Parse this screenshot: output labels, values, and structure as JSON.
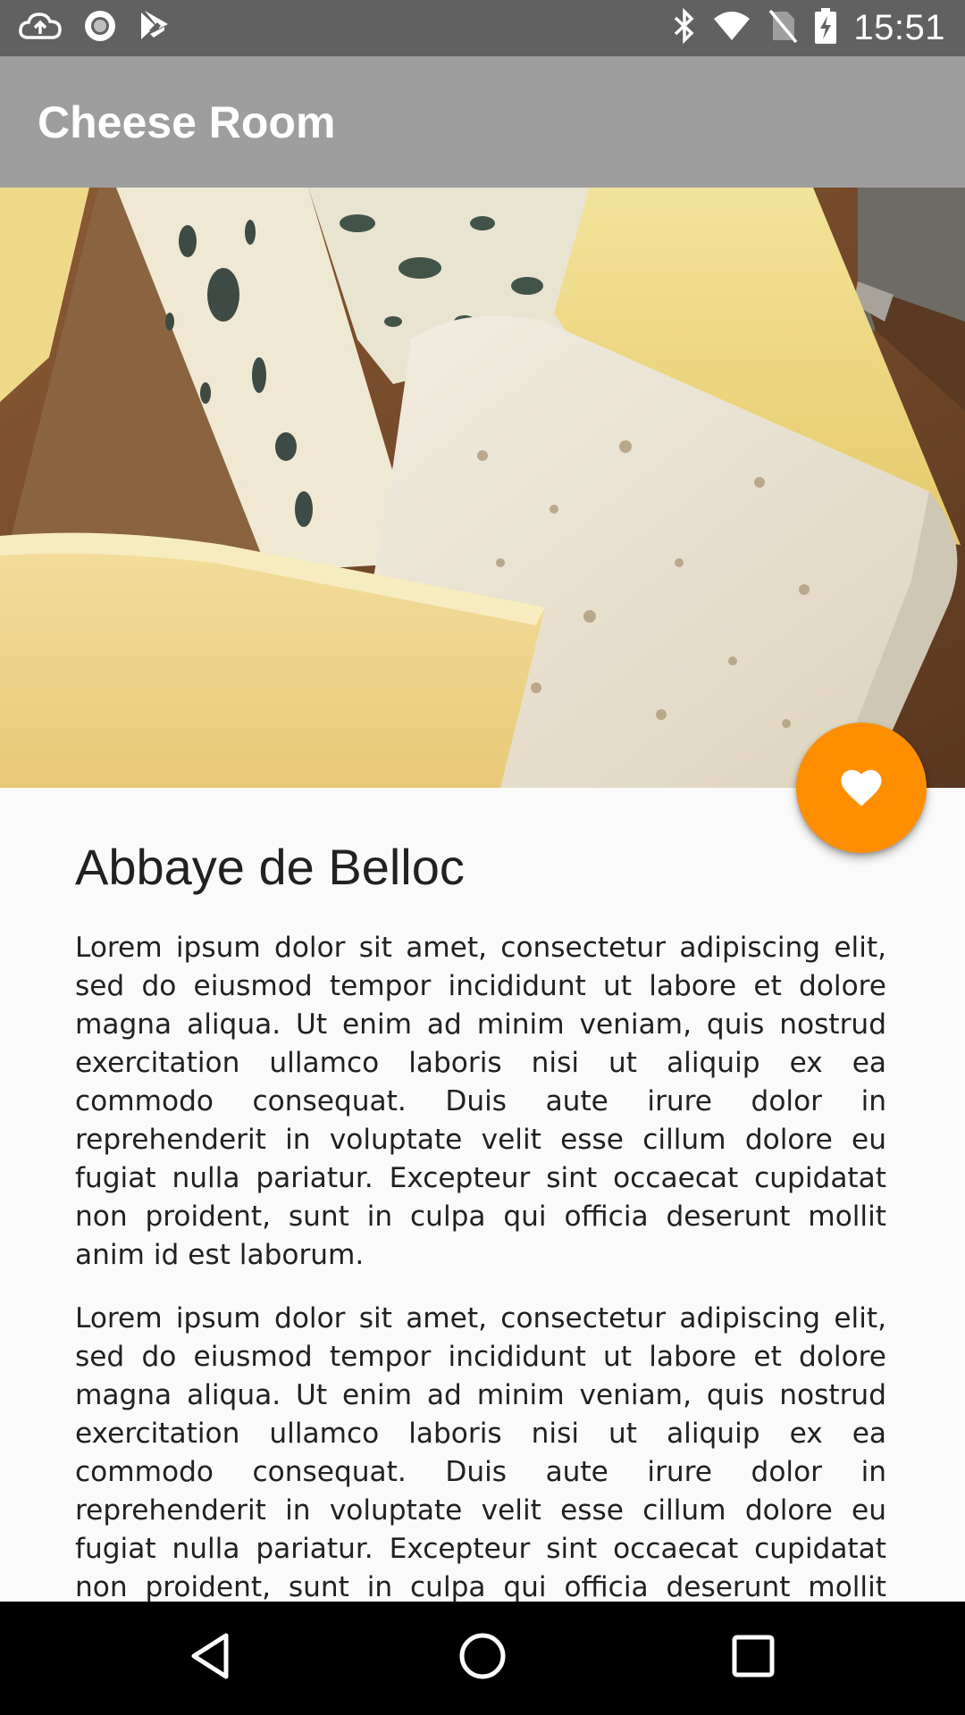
{
  "status_bar": {
    "time": "15:51",
    "left_icons": [
      "cloud-upload-icon",
      "sync-circle-icon",
      "play-store-icon"
    ],
    "right_icons": [
      "bluetooth-icon",
      "wifi-icon",
      "no-sim-icon",
      "battery-charging-icon"
    ]
  },
  "app_bar": {
    "title": "Cheese Room"
  },
  "hero": {
    "image": "cheese-platter-image"
  },
  "fab": {
    "icon": "heart-icon",
    "color": "#ff8f00"
  },
  "detail": {
    "title": "Abbaye de Belloc",
    "paragraphs": [
      "Lorem ipsum dolor sit amet, consectetur adipiscing elit, sed do eiusmod tempor incididunt ut labore et dolore magna aliqua. Ut enim ad minim veniam, quis nostrud exercitation ullamco laboris nisi ut aliquip ex ea commodo consequat. Duis aute irure dolor in reprehenderit in voluptate velit esse cillum dolore eu fugiat nulla pariatur. Excepteur sint occaecat cupidatat non proident, sunt in culpa qui officia deserunt mollit anim id est laborum.",
      "Lorem ipsum dolor sit amet, consectetur adipiscing elit, sed do eiusmod tempor incididunt ut labore et dolore magna aliqua. Ut enim ad minim veniam, quis nostrud exercitation ullamco laboris nisi ut aliquip ex ea commodo consequat. Duis aute irure dolor in reprehenderit in voluptate velit esse cillum dolore eu fugiat nulla pariatur. Excepteur sint occaecat cupidatat non proident, sunt in culpa qui officia deserunt mollit anim id est laborum."
    ]
  },
  "nav_bar": {
    "buttons": [
      "back-icon",
      "home-icon",
      "recents-icon"
    ]
  },
  "colors": {
    "status_bar": "#616161",
    "app_bar": "#9e9e9e",
    "accent": "#ff8f00",
    "background": "#fafafa",
    "text": "#212121"
  }
}
